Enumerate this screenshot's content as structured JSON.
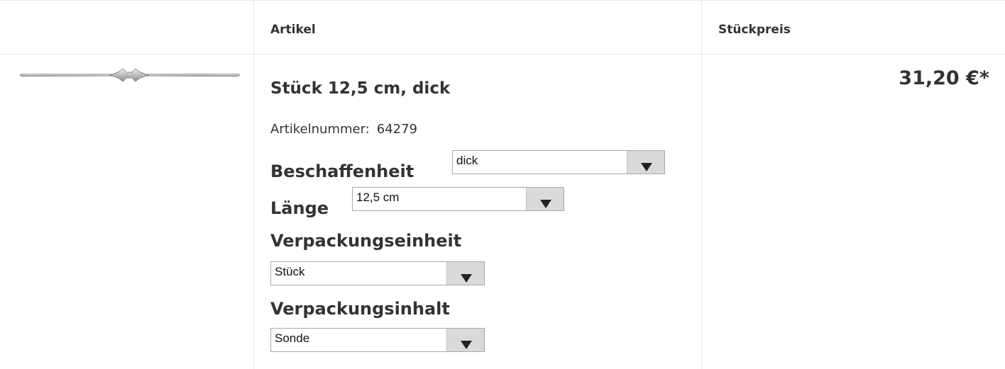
{
  "table": {
    "header": {
      "article": "Artikel",
      "unit_price": "Stückpreis"
    },
    "row": {
      "image": "product-probe-image",
      "title": "Stück 12,5 cm, dick",
      "article_number_label": "Artikelnummer:",
      "article_number": "64279",
      "options": [
        {
          "label": "Beschaffenheit",
          "value": "dick"
        },
        {
          "label": "Länge",
          "value": "12,5 cm"
        },
        {
          "label": "Verpackungseinheit",
          "value": "Stück"
        },
        {
          "label": "Verpackungsinhalt",
          "value": "Sonde"
        }
      ],
      "price": "31,20 €*"
    }
  },
  "colors": {
    "text": "#333333",
    "border": "#e8e8e8",
    "select_arrow_bg": "#dadada"
  }
}
